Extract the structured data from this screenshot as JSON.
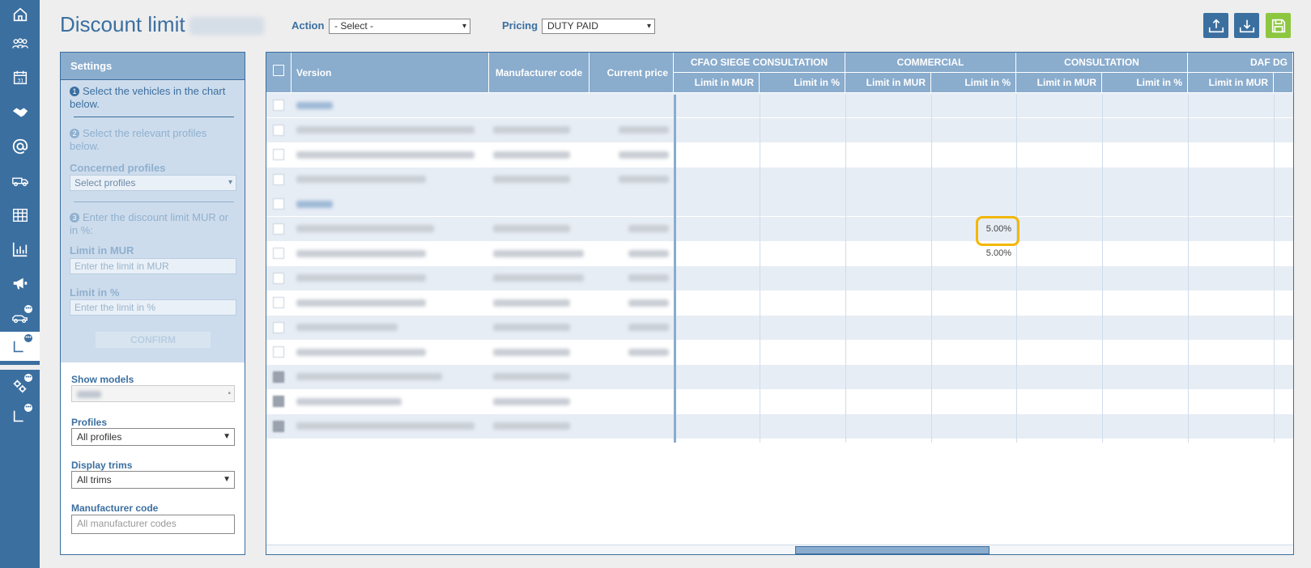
{
  "header": {
    "title": "Discount limit",
    "action_label": "Action",
    "action_value": "- Select -",
    "pricing_label": "Pricing",
    "pricing_value": "DUTY PAID"
  },
  "toolbar_icons": [
    "export-icon",
    "import-icon",
    "save-icon"
  ],
  "nav_icons": [
    "home-icon",
    "people-icon",
    "calendar-icon",
    "handshake-icon",
    "at-icon",
    "vehicles-icon",
    "table-icon",
    "bar-chart-icon",
    "megaphone-icon",
    "car-chat-icon",
    "chart-chat-icon",
    "gears-chat-icon",
    "chart-chat-icon-2"
  ],
  "settings": {
    "header": "Settings",
    "step1": "Select the vehicles in the chart below.",
    "step2": "Select the relevant profiles below.",
    "concerned_profiles_label": "Concerned profiles",
    "concerned_profiles_value": "Select profiles",
    "step3": "Enter the discount limit MUR or in %:",
    "limit_mur_label": "Limit in MUR",
    "limit_mur_placeholder": "Enter the limit in MUR",
    "limit_pct_label": "Limit in %",
    "limit_pct_placeholder": "Enter the limit in %",
    "confirm_label": "CONFIRM",
    "show_models_label": "Show models",
    "profiles_label": "Profiles",
    "profiles_value": "All profiles",
    "display_trims_label": "Display trims",
    "display_trims_value": "All trims",
    "manufacturer_code_label": "Manufacturer code",
    "manufacturer_code_placeholder": "All manufacturer codes"
  },
  "grid": {
    "columns": {
      "version": "Version",
      "manufacturer_code": "Manufacturer code",
      "current_price": "Current price"
    },
    "profile_groups": [
      "CFAO SIEGE CONSULTATION",
      "COMMERCIAL",
      "CONSULTATION",
      "DAF DG"
    ],
    "sub_columns": [
      "Limit in MUR",
      "Limit in %",
      "Limit in MUR",
      "Limit in %",
      "Limit in MUR",
      "Limit in %",
      "Limit in MUR"
    ],
    "rows": [
      {
        "type": "group",
        "limit_pct_commercial": ""
      },
      {
        "type": "row",
        "limit_pct_commercial": ""
      },
      {
        "type": "row",
        "limit_pct_commercial": ""
      },
      {
        "type": "row",
        "limit_pct_commercial": ""
      },
      {
        "type": "group",
        "limit_pct_commercial": ""
      },
      {
        "type": "row",
        "limit_pct_commercial": "5.00%"
      },
      {
        "type": "row",
        "limit_pct_commercial": "5.00%"
      },
      {
        "type": "row",
        "limit_pct_commercial": ""
      },
      {
        "type": "row",
        "limit_pct_commercial": ""
      },
      {
        "type": "row",
        "limit_pct_commercial": ""
      },
      {
        "type": "row",
        "limit_pct_commercial": ""
      },
      {
        "type": "row-dark",
        "limit_pct_commercial": ""
      },
      {
        "type": "row-dark",
        "limit_pct_commercial": ""
      },
      {
        "type": "row-dark",
        "limit_pct_commercial": ""
      }
    ]
  },
  "colors": {
    "brand": "#3b6fa0",
    "header_bg": "#8aaccd",
    "highlight": "#f2b705",
    "save": "#8dc63f"
  }
}
